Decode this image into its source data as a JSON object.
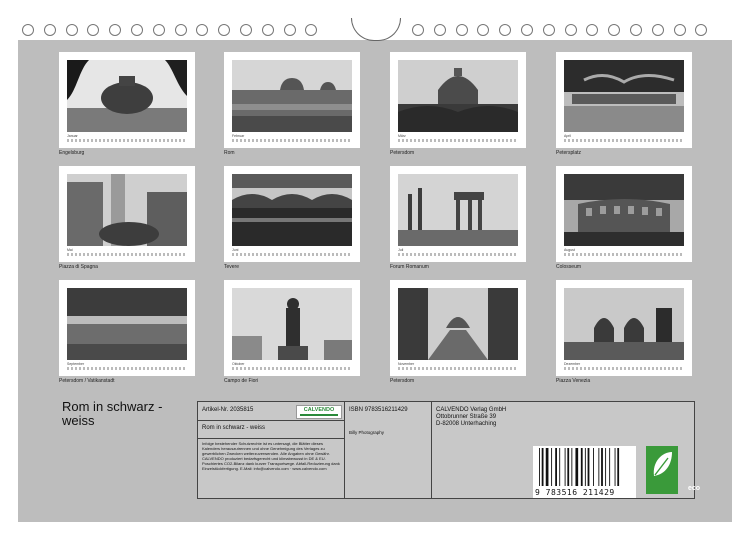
{
  "calendar": {
    "months": [
      {
        "month": "Januar",
        "caption": "Engelsburg"
      },
      {
        "month": "Februar",
        "caption": "Rom"
      },
      {
        "month": "März",
        "caption": "Petersdom"
      },
      {
        "month": "April",
        "caption": "Petersplatz"
      },
      {
        "month": "Mai",
        "caption": "Piazza di Spagna"
      },
      {
        "month": "Juni",
        "caption": "Tevere"
      },
      {
        "month": "Juli",
        "caption": "Forum Romanum"
      },
      {
        "month": "August",
        "caption": "Colosseum"
      },
      {
        "month": "September",
        "caption": "Petersdom / Vatikanstadt"
      },
      {
        "month": "Oktober",
        "caption": "Campo de Fiori"
      },
      {
        "month": "November",
        "caption": "Petersdom"
      },
      {
        "month": "Dezember",
        "caption": "Piazza Venezia"
      }
    ],
    "title": "Rom in schwarz - weiss"
  },
  "info": {
    "article_no": "Artikel-Nr. 2035815",
    "product_title": "Rom in schwarz - weiss",
    "legal_text": "Infolge bestehender Schutzrechte ist es untersagt, die Blätter dieses Kalenders herauszutrennen und ohne Genehmigung des Verlages zu gewerblichen Zwecken weiterzuverwenden. Alle Angaben ohne Gewähr. CALVENDO produziert bedarfsgerecht und klimabewusst in DE & EU. Poschiertes CO2-Bilanz dank kurzer Transportwege. Abfall-Reduzierung dank Einzelstückfertigung. E-Mail: info@calvendo.com · www.calvendo.com",
    "logo_text": "CALVENDO",
    "isbn": "ISBN 9783516211429",
    "author": "Billy Photography",
    "publisher_line1": "CALVENDO Verlag GmbH",
    "publisher_line2": "Ottobrunner Straße 39",
    "publisher_line3": "D-82008 Unterhaching",
    "barcode_number": "9 783516 211429",
    "eco_label": "eco"
  }
}
